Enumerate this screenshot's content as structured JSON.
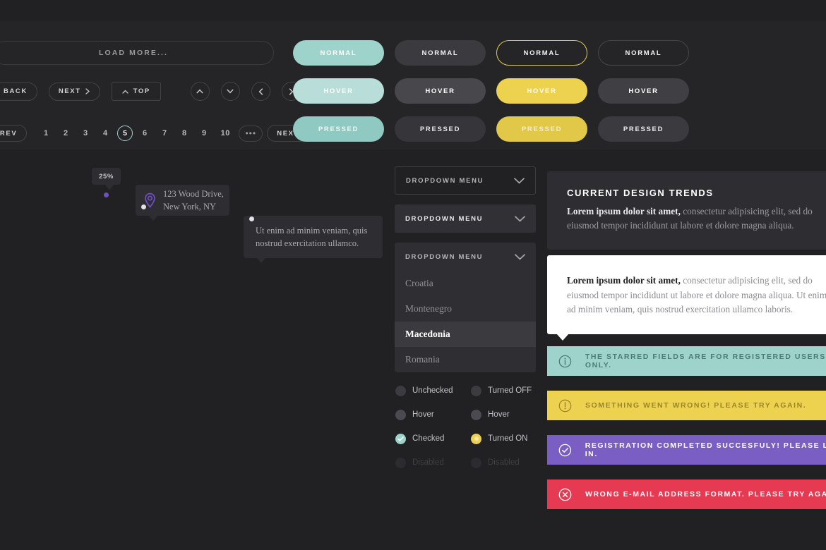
{
  "colors": {
    "bg": "#212123",
    "panel": "#252527",
    "teal": "#9ed3cc",
    "yellow": "#edd250",
    "purple": "#7b5ec4",
    "red": "#e53a52",
    "gray_btn": "#3b3b3f",
    "pin_purple": "#6f4fc4"
  },
  "nav": {
    "load_more": "LOAD MORE...",
    "back": "BACK",
    "next": "NEXT",
    "top": "TOP",
    "circle_icons": [
      "chevron-up-icon",
      "chevron-down-icon",
      "chevron-left-icon",
      "chevron-right-icon"
    ]
  },
  "pagination": {
    "prev": "PREV",
    "next": "NEXT",
    "pages": [
      "1",
      "2",
      "3",
      "4",
      "5",
      "6",
      "7",
      "8",
      "9",
      "10"
    ],
    "active_page": "5",
    "ellipsis": "•••"
  },
  "buttons": {
    "columns": [
      {
        "name": "teal",
        "states": [
          "NORMAL",
          "HOVER",
          "PRESSED"
        ]
      },
      {
        "name": "gray",
        "states": [
          "NORMAL",
          "HOVER",
          "PRESSED"
        ]
      },
      {
        "name": "yellow-outline",
        "states": [
          "NORMAL",
          "HOVER",
          "PRESSED"
        ]
      },
      {
        "name": "dark",
        "states": [
          "NORMAL",
          "HOVER",
          "PRESSED"
        ]
      }
    ]
  },
  "tooltips": {
    "percent": "25%",
    "address_line1": "123 Wood Drive,",
    "address_line2": "New York, NY",
    "lorem_line1": "Ut enim ad minim veniam, quis",
    "lorem_line2": "nostrud exercitation ullamco."
  },
  "dropdowns": {
    "label": "DROPDOWN MENU",
    "items": [
      "Croatia",
      "Montenegro",
      "Macedonia",
      "Romania"
    ],
    "selected": "Macedonia"
  },
  "checkboxes": [
    {
      "label": "Unchecked",
      "state": "off"
    },
    {
      "label": "Hover",
      "state": "hover"
    },
    {
      "label": "Checked",
      "state": "checked"
    },
    {
      "label": "Disabled",
      "state": "disabled"
    }
  ],
  "toggles": [
    {
      "label": "Turned OFF",
      "state": "off"
    },
    {
      "label": "Hover",
      "state": "hover"
    },
    {
      "label": "Turned ON",
      "state": "on"
    },
    {
      "label": "Disabled",
      "state": "disabled"
    }
  ],
  "trends": {
    "title": "CURRENT DESIGN TRENDS",
    "lead": "Lorem ipsum dolor sit amet,",
    "rest": " consectetur adipisicing elit, sed do eiusmod tempor incididunt ut labore et dolore magna aliqua."
  },
  "white_card": {
    "lead": "Lorem ipsum dolor sit amet,",
    "rest": " consectetur adipisicing elit, sed do eiusmod tempor incididunt ut labore et dolore magna aliqua. Ut enim ad minim veniam, quis nostrud exercitation ullamco laboris."
  },
  "alerts": [
    {
      "type": "info",
      "icon": "info-circle-icon",
      "text": "THE STARRED FIELDS ARE FOR REGISTERED USERS ONLY."
    },
    {
      "type": "warn",
      "icon": "alert-circle-icon",
      "text": "SOMETHING WENT WRONG! PLEASE TRY AGAIN."
    },
    {
      "type": "success",
      "icon": "check-circle-icon",
      "text": "REGISTRATION COMPLETED SUCCESFULY! PLEASE LOG IN."
    },
    {
      "type": "error",
      "icon": "x-circle-icon",
      "text": "WRONG E-MAIL ADDRESS FORMAT. PLEASE TRY AGAIN."
    }
  ]
}
